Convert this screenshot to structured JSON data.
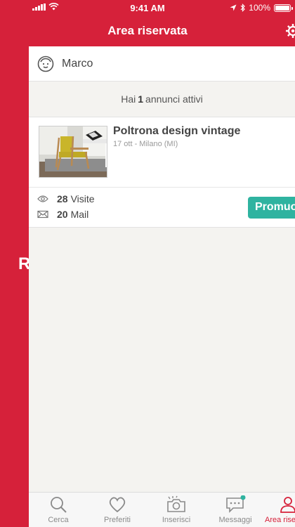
{
  "status_bar": {
    "time": "9:41 AM",
    "battery": "100%",
    "battery_level": 1.0
  },
  "header": {
    "title": "Area riservata"
  },
  "side": {
    "letter": "R"
  },
  "user": {
    "name": "Marco"
  },
  "summary": {
    "prefix": "Hai",
    "count": "1",
    "suffix": "annunci attivi"
  },
  "ad": {
    "title": "Poltrona design vintage",
    "meta": "17 ott - Milano (MI)",
    "visits_count": "28",
    "visits_label": "Visite",
    "mails_count": "20",
    "mails_label": "Mail",
    "promote_label": "Promuovi"
  },
  "tabs": [
    {
      "label": "Cerca",
      "icon": "search-icon"
    },
    {
      "label": "Preferiti",
      "icon": "heart-icon"
    },
    {
      "label": "Inserisci",
      "icon": "camera-icon"
    },
    {
      "label": "Messaggi",
      "icon": "chat-icon"
    },
    {
      "label": "Area riservata",
      "icon": "user-icon"
    }
  ],
  "colors": {
    "brand": "#d6213a",
    "accent": "#2fb3a0",
    "background": "#f4f3f0"
  }
}
